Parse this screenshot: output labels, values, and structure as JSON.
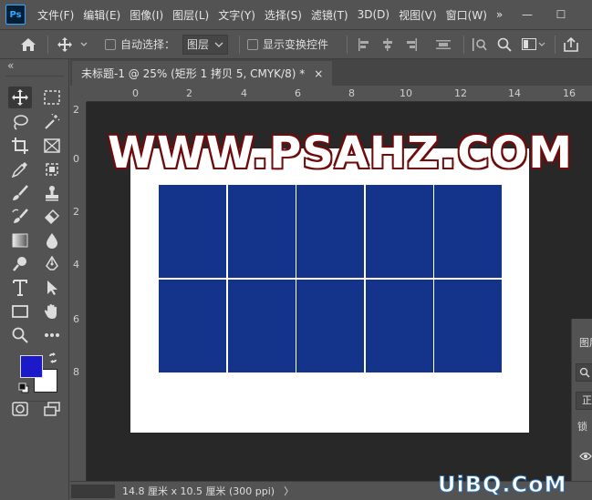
{
  "app": {
    "logo_text": "Ps"
  },
  "menu": [
    "文件(F)",
    "编辑(E)",
    "图像(I)",
    "图层(L)",
    "文字(Y)",
    "选择(S)",
    "滤镜(T)",
    "3D(D)",
    "视图(V)",
    "窗口(W)"
  ],
  "menu_more": "»",
  "window_buttons": {
    "minimize": "—",
    "maximize": "☐"
  },
  "options": {
    "auto_select_label": "自动选择：",
    "auto_select_value": "图层",
    "show_transform_label": "显示变换控件",
    "more": "···"
  },
  "panel_collapse": "«",
  "document_tab": {
    "title": "未标题-1 @ 25% (矩形 1 拷贝 5, CMYK/8) *",
    "close": "×"
  },
  "ruler_h_labels": [
    "0",
    "2",
    "4",
    "6",
    "8",
    "10",
    "12",
    "14",
    "16"
  ],
  "ruler_v_labels": [
    "2",
    "0",
    "2",
    "4",
    "6",
    "8"
  ],
  "colors": {
    "foreground": "#1a1ac8",
    "background": "#ffffff",
    "tile": "#14338a",
    "canvas_bg": "#282828"
  },
  "canvas_watermark": "WWW.PSAHZ.COM",
  "grid": {
    "rows": 2,
    "cols": 5
  },
  "status": {
    "doc_size": "14.8 厘米 x 10.5 厘米 (300 ppi)",
    "arrow": "〉"
  },
  "right_panel": {
    "tab": "图层",
    "mode": "正",
    "lock": "锁"
  },
  "site_mark": "UiBQ.CoM"
}
